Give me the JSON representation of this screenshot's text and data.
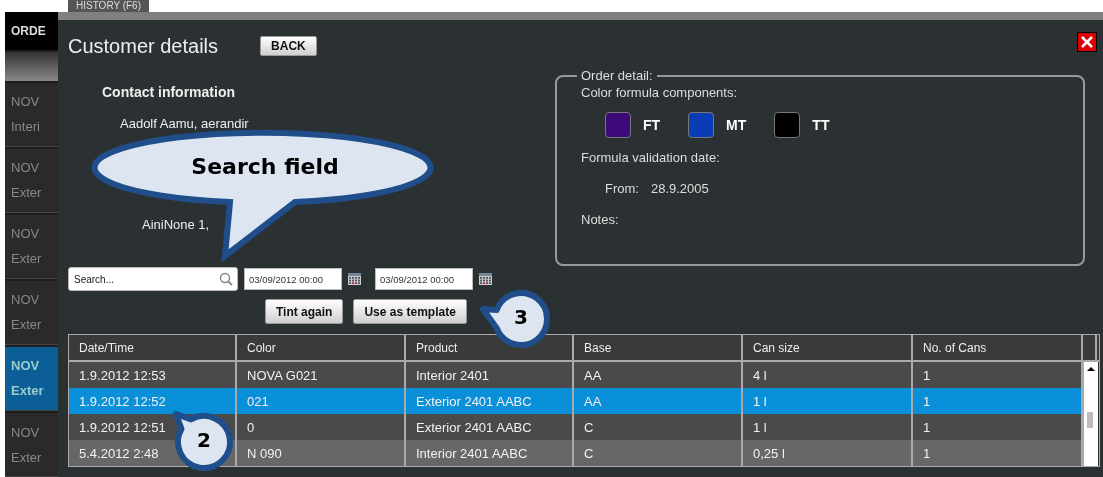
{
  "background_tab": "HISTORY (F6)",
  "sidebar": {
    "header": "ORDE",
    "items": [
      {
        "line1": "NOV",
        "line2": "Interi",
        "selected": false
      },
      {
        "line1": "NOV",
        "line2": "Exter",
        "selected": false
      },
      {
        "line1": "NOV",
        "line2": "Exter",
        "selected": false
      },
      {
        "line1": "NOV",
        "line2": "Exter",
        "selected": false
      },
      {
        "line1": "NOV",
        "line2": "Exter",
        "selected": true
      },
      {
        "line1": "NOV",
        "line2": "Exter",
        "selected": false
      }
    ]
  },
  "dialog": {
    "title": "Customer details",
    "back_button": "BACK",
    "contact": {
      "heading": "Contact information",
      "lines": [
        "Aadolf Aamu, aerandir",
        "AiniNone 1,"
      ]
    },
    "order_detail": {
      "legend": "Order detail:",
      "components_label": "Color formula components:",
      "components": [
        {
          "name": "FT",
          "color": "#3d0a7a"
        },
        {
          "name": "MT",
          "color": "#0a3db5"
        },
        {
          "name": "TT",
          "color": "#000000"
        }
      ],
      "validation_label": "Formula validation date:",
      "from_label": "From:",
      "from_value": "28.9.2005",
      "notes_label": "Notes:"
    },
    "search": {
      "placeholder": "Search..."
    },
    "date_from": "03/09/2012 00:00",
    "date_to": "03/09/2012 00:00",
    "buttons": [
      "Tint again",
      "Use as template"
    ],
    "table": {
      "columns": [
        "Date/Time",
        "Color",
        "Product",
        "Base",
        "Can size",
        "No. of Cans"
      ],
      "rows": [
        {
          "cells": [
            "1.9.2012 12:53",
            "NOVA G021",
            "Interior 2401",
            "AA",
            "4 l",
            "1"
          ],
          "selected": false
        },
        {
          "cells": [
            "1.9.2012 12:52",
            "021",
            "Exterior 2401 AABC",
            "AA",
            "1 l",
            "1"
          ],
          "selected": true
        },
        {
          "cells": [
            "1.9.2012 12:51",
            "0",
            "Exterior 2401 AABC",
            "C",
            "1 l",
            "1"
          ],
          "selected": false
        },
        {
          "cells": [
            "5.4.2012 2:48",
            "N 090",
            "Interior 2401 AABC",
            "C",
            "0,25 l",
            "1"
          ],
          "selected": false
        }
      ]
    }
  },
  "callouts": [
    {
      "kind": "speech",
      "text": "Search field"
    },
    {
      "kind": "number",
      "text": "2"
    },
    {
      "kind": "number",
      "text": "3"
    }
  ]
}
